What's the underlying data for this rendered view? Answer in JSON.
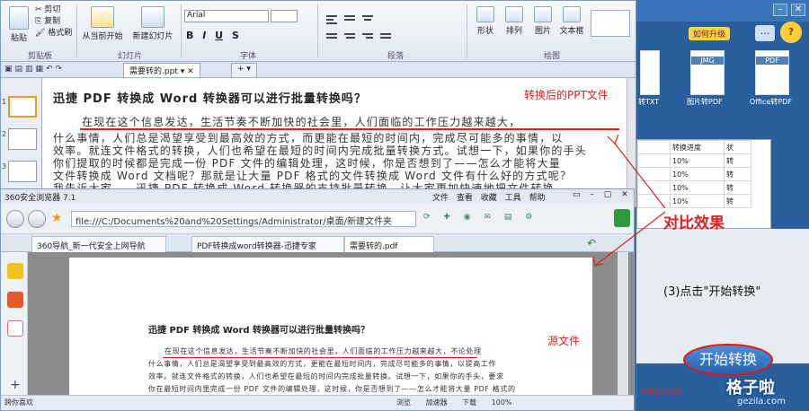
{
  "wps": {
    "ribbon": {
      "clipboard": {
        "paste": "粘贴",
        "cut": "剪切",
        "copy": "复制",
        "format_painter": "格式刷",
        "group": "剪贴板"
      },
      "play": {
        "from_start": "从当前开始",
        "new_slide": "新建幻灯片",
        "group": "幻灯片"
      },
      "font": {
        "name": "Arial",
        "size": "",
        "group": "字体",
        "bold": "B",
        "italic": "I",
        "underline": "U",
        "strike": "S"
      },
      "paragraph": {
        "group": "段落"
      },
      "drawing": {
        "shapes": "形状",
        "arrange": "排列",
        "picture": "图片",
        "text_box": "文本框",
        "group": "绘图"
      }
    },
    "doc_tab": "需要转的.ppt",
    "slide": {
      "title": "迅捷 PDF 转换成 Word 转换器可以进行批量转换吗？",
      "line1": "在现在这个信息发达，生活节奏不断加快的社会里，人们面临的工作压力越来越大，",
      "line2": "什么事情，人们总是渴望享受到最高效的方式，而更能在最短的时间内，完成尽可能多的事情，以",
      "line3": "效率。就连文件格式的转换，人们也希望在最短的时间内完成批量转换方式。试想一下，如果你的手头",
      "line4": "你们提取的时候都是完成一份 PDF 文件的编辑处理，这时候，你是否想到了——怎么才能将大量",
      "line5": "文件转换成 Word 文档呢？那就是让大量 PDF 格式的文件转换成 Word 文件有什么好的方式呢？",
      "line6": "我告诉大家——迅捷 PDF 转换成 Word 转换器的支持批量转换，让大家更加快速地把文件转换"
    },
    "annotation_converted": "转换后的PPT文件"
  },
  "rightapp": {
    "badge": "如何升级",
    "cards": [
      {
        "label": "JMG",
        "caption": "图片转PDF"
      },
      {
        "label": "PDF",
        "caption": "Office转PDF"
      }
    ],
    "partial_caption": "转TXT",
    "grid": {
      "headers": [
        "转换进度",
        "状"
      ],
      "rows": [
        [
          "10%",
          "转"
        ],
        [
          "10%",
          "转"
        ],
        [
          "10%",
          "转"
        ],
        [
          "10%",
          "转"
        ]
      ]
    },
    "step_note": "(3)点击\"开始转换\"",
    "start_button": "开始转换"
  },
  "browser": {
    "title": "360安全浏览器 7.1",
    "menu": [
      "文件",
      "查看",
      "收藏",
      "工具",
      "帮助"
    ],
    "address": "file:///C:/Documents%20and%20Settings/Administrator/桌面/新建文件夹",
    "tabs": [
      "360导航_新一代安全上网导航",
      "PDF转换成word转换器-迅捷专家",
      "需要转的.pdf"
    ],
    "pdf": {
      "title": "迅捷 PDF 转换成 Word 转换器可以进行批量转换吗？",
      "line1": "在现在这个信息发达，生活节奏不断加快的社会里，人们面临的工作压力越来越大，不论处理",
      "line2": "什么事情，人们总是渴望享受到最高效的方式，更能在最短时间内，完成尽可能多的事情，以提高工作",
      "line3": "效率。就连文件格式的转换，人们也希望在最短的时间内完成批量转换。试想一下，如果你的手头，要求",
      "line4": "你在最短时间内里完成一份 PDF 文件的编辑处理，这时候，你是否想到了——怎么才能将大量 PDF 格式的"
    },
    "annotation_source": "源文件",
    "status_left": "跨你喜欢",
    "status_items": [
      "浏览",
      "加速器",
      "下载",
      "100%"
    ]
  },
  "annotation_compare": "对比效果",
  "watermark": "格子啦",
  "watermark_sub": "gezila.com",
  "footer_fragment": "40030095"
}
